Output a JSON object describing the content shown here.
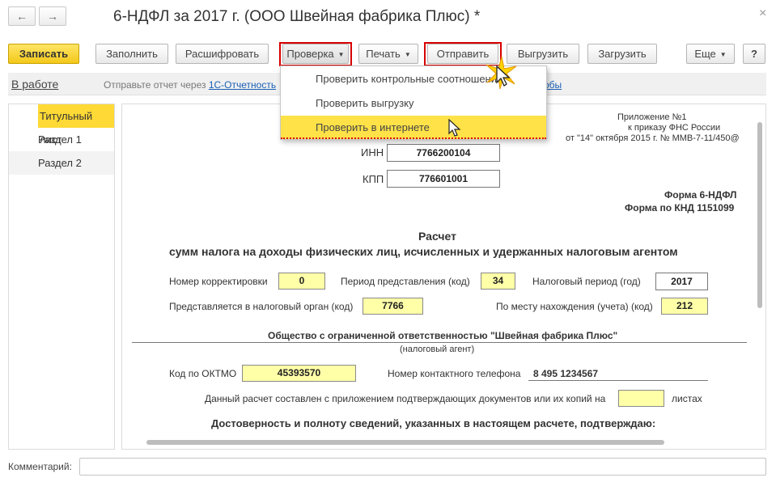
{
  "window": {
    "title": "6-НДФЛ за 2017 г. (ООО Швейная фабрика Плюс) *",
    "back_glyph": "←",
    "forward_glyph": "→",
    "close_glyph": "×"
  },
  "toolbar": {
    "save": "Записать",
    "fill": "Заполнить",
    "decode": "Расшифровать",
    "check": "Проверка",
    "print": "Печать",
    "send": "Отправить",
    "export": "Выгрузить",
    "import": "Загрузить",
    "more": "Еще",
    "help": "?",
    "caret": "▼"
  },
  "status": {
    "state": "В работе",
    "send_prefix": "Отправьте отчет через ",
    "send_link": "1С-Отчетность",
    "link_tail": "обы"
  },
  "dropdown": {
    "items": [
      "Проверить контрольные соотношения",
      "Проверить выгрузку",
      "Проверить в интернете"
    ]
  },
  "sections": [
    "Титульный лист",
    "Раздел 1",
    "Раздел 2"
  ],
  "form": {
    "appendix": [
      "Приложение №1",
      "к приказу ФНС России",
      "от \"14\" октября 2015 г. № ММВ-7-11/450@"
    ],
    "inn_label": "ИНН",
    "inn": "7766200104",
    "kpp_label": "КПП",
    "kpp": "776601001",
    "form_name": "Форма 6-НДФЛ",
    "knd": "Форма по КНД 1151099",
    "heading": "Расчет",
    "subheading": "сумм налога на доходы физических лиц, исчисленных и удержанных налоговым агентом",
    "correction_label": "Номер корректировки",
    "correction": "0",
    "period_code_label": "Период представления (код)",
    "period_code": "34",
    "tax_period_label": "Налоговый период (год)",
    "tax_period": "2017",
    "tax_office_label": "Представляется в налоговый орган (код)",
    "tax_office": "7766",
    "location_label": "По месту нахождения (учета) (код)",
    "location": "212",
    "org_name": "Общество с ограниченной ответственностью \"Швейная фабрика Плюс\"",
    "agent_caption": "(налоговый агент)",
    "oktmo_label": "Код по ОКТМО",
    "oktmo": "45393570",
    "phone_label": "Номер контактного телефона",
    "phone": "8 495 1234567",
    "pages_text": "Данный расчет составлен с приложением подтверждающих документов или их копий на",
    "pages_value": "",
    "pages_suffix": "листах",
    "confirm": "Достоверность и полноту сведений, указанных в настоящем расчете, подтверждаю:"
  },
  "comment": {
    "label": "Комментарий:",
    "value": ""
  },
  "colors": {
    "accent_yellow": "#ffd935",
    "highlight_red": "#d80000",
    "link_blue": "#1a5fb4"
  }
}
